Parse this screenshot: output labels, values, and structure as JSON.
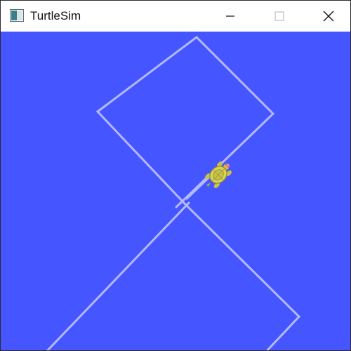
{
  "window": {
    "title": "TurtleSim",
    "controls": {
      "minimize": "minimize",
      "maximize": "maximize",
      "close": "close"
    }
  },
  "canvas": {
    "background_color": "#4555ff",
    "pen_color": "#b3b8ff",
    "turtle_icon": "turtle-icon"
  }
}
